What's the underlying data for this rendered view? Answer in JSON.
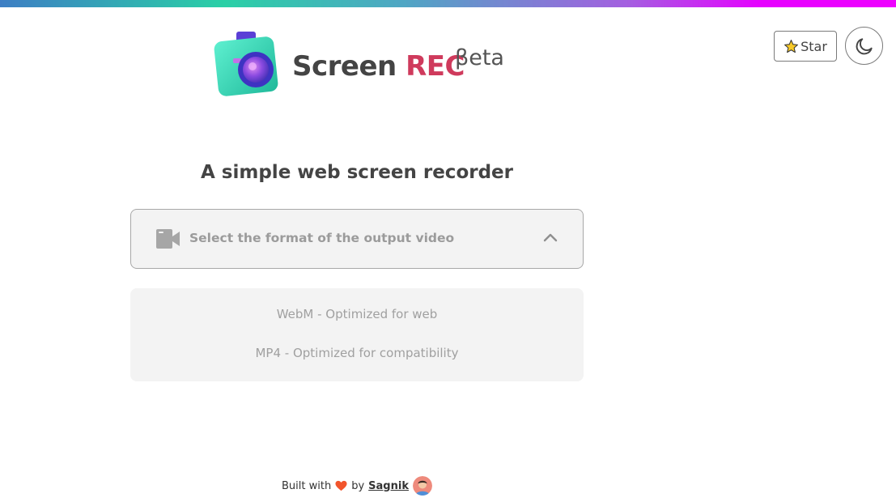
{
  "brand": {
    "name": "Screen",
    "name_accent": "REC",
    "badge": "βeta"
  },
  "header": {
    "star_label": "Star",
    "theme_icon": "moon-icon"
  },
  "main": {
    "tagline": "A simple web screen recorder",
    "format_select": {
      "icon": "video-camera-icon",
      "placeholder": "Select the format of the output video",
      "state": "expanded",
      "options": [
        "WebM - Optimized for web",
        "MP4 - Optimized for compatibility"
      ]
    }
  },
  "footer": {
    "built_with": "Built with",
    "by": "by",
    "author": "Sagnik"
  },
  "colors": {
    "accent_rec": "#cf3a5c",
    "heart": "#f2552c",
    "gradient_start": "#3d7ec4",
    "gradient_end": "#ee00ff"
  }
}
